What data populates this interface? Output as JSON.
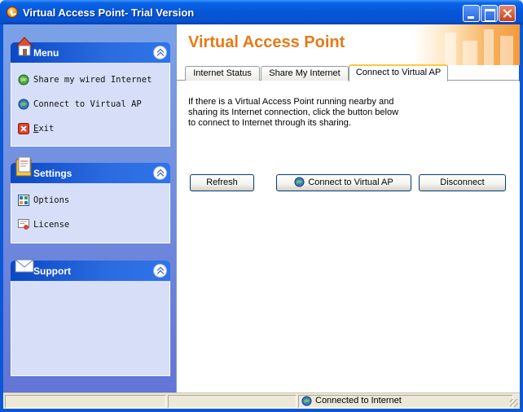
{
  "window": {
    "title": "Virtual Access Point- Trial Version"
  },
  "sidebar": {
    "menu": {
      "title": "Menu",
      "items": [
        {
          "label": "Share my wired Internet"
        },
        {
          "label": "Connect to Virtual AP"
        },
        {
          "label_accel": "E",
          "label_rest": "xit"
        }
      ]
    },
    "settings": {
      "title": "Settings",
      "items": [
        {
          "label": "Options"
        },
        {
          "label": "License"
        }
      ]
    },
    "support": {
      "title": "Support"
    }
  },
  "banner": {
    "title": "Virtual Access Point"
  },
  "tabs": [
    {
      "label": "Internet Status"
    },
    {
      "label": "Share My Internet"
    },
    {
      "label": "Connect to Virtual AP"
    }
  ],
  "active_tab": 2,
  "panel": {
    "description_lines": [
      "If there is a Virtual Access Point running nearby and",
      "sharing its Internet connection, click the button below",
      "to connect to Internet through its sharing."
    ],
    "buttons": {
      "refresh": "Refresh",
      "connect": "Connect to Virtual AP",
      "disconnect": "Disconnect"
    }
  },
  "statusbar": {
    "status_text": "Connected to Internet"
  },
  "colors": {
    "titlebar": "#0756D6",
    "banner_title": "#E67A17",
    "pane_bg": "#6F8CDE",
    "group_body": "#D6DFF7"
  },
  "icons": {
    "app": "orange-circle-icon",
    "menu_group": "house-icon",
    "settings_group": "settings-folder-icon",
    "support_group": "envelope-icon",
    "share": "globe-icon",
    "connect": "globe-arrow-icon",
    "exit": "red-x-icon",
    "options": "options-grid-icon",
    "license": "certificate-icon",
    "status": "globe-icon"
  }
}
